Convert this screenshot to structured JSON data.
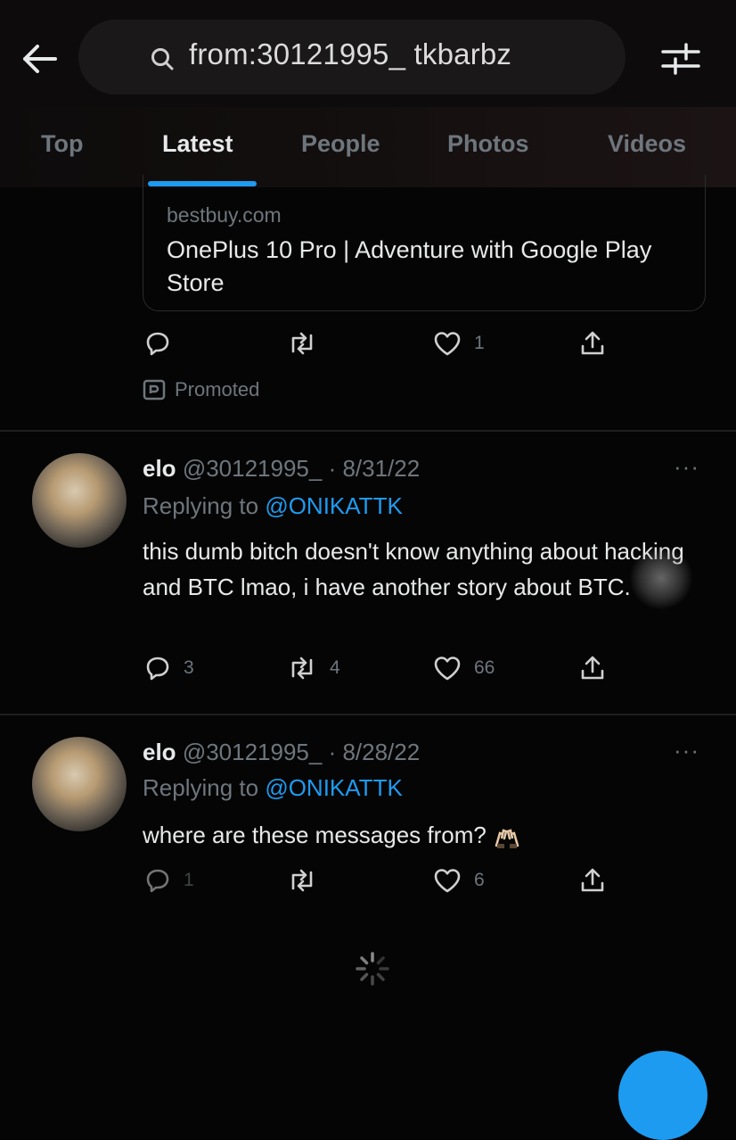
{
  "search": {
    "query": "from:30121995_ tkbarbz"
  },
  "tabs": [
    {
      "label": "Top"
    },
    {
      "label": "Latest"
    },
    {
      "label": "People"
    },
    {
      "label": "Photos"
    },
    {
      "label": "Videos"
    }
  ],
  "promo": {
    "domain": "bestbuy.com",
    "title": "OnePlus 10 Pro | Adventure with Google Play Store",
    "likes": "1",
    "promoted_label": "Promoted"
  },
  "tweets": [
    {
      "name": "elo",
      "handle_date": "@30121995_ · 8/31/22",
      "replying_prefix": "Replying to ",
      "replying_to": "@ONIKATTK",
      "text": "this dumb bitch doesn't know anything about hacking and BTC lmao, i have another story about BTC.",
      "replies": "3",
      "retweets": "4",
      "likes": "66",
      "more": "···"
    },
    {
      "name": "elo",
      "handle_date": "@30121995_ · 8/28/22",
      "replying_prefix": "Replying to ",
      "replying_to": "@ONIKATTK",
      "text": "where are these messages from?",
      "replies": "1",
      "retweets": "",
      "likes": "6",
      "more": "···"
    }
  ],
  "icons": {
    "back": "back-arrow-icon",
    "search": "search-icon",
    "filter": "filter-sliders-icon",
    "reply": "reply-icon",
    "retweet": "retweet-icon",
    "like": "heart-icon",
    "share": "share-icon",
    "spinner": "loading-spinner-icon"
  },
  "colors": {
    "accent": "#1d9bf0",
    "background": "#050505",
    "muted": "#6e767d"
  }
}
